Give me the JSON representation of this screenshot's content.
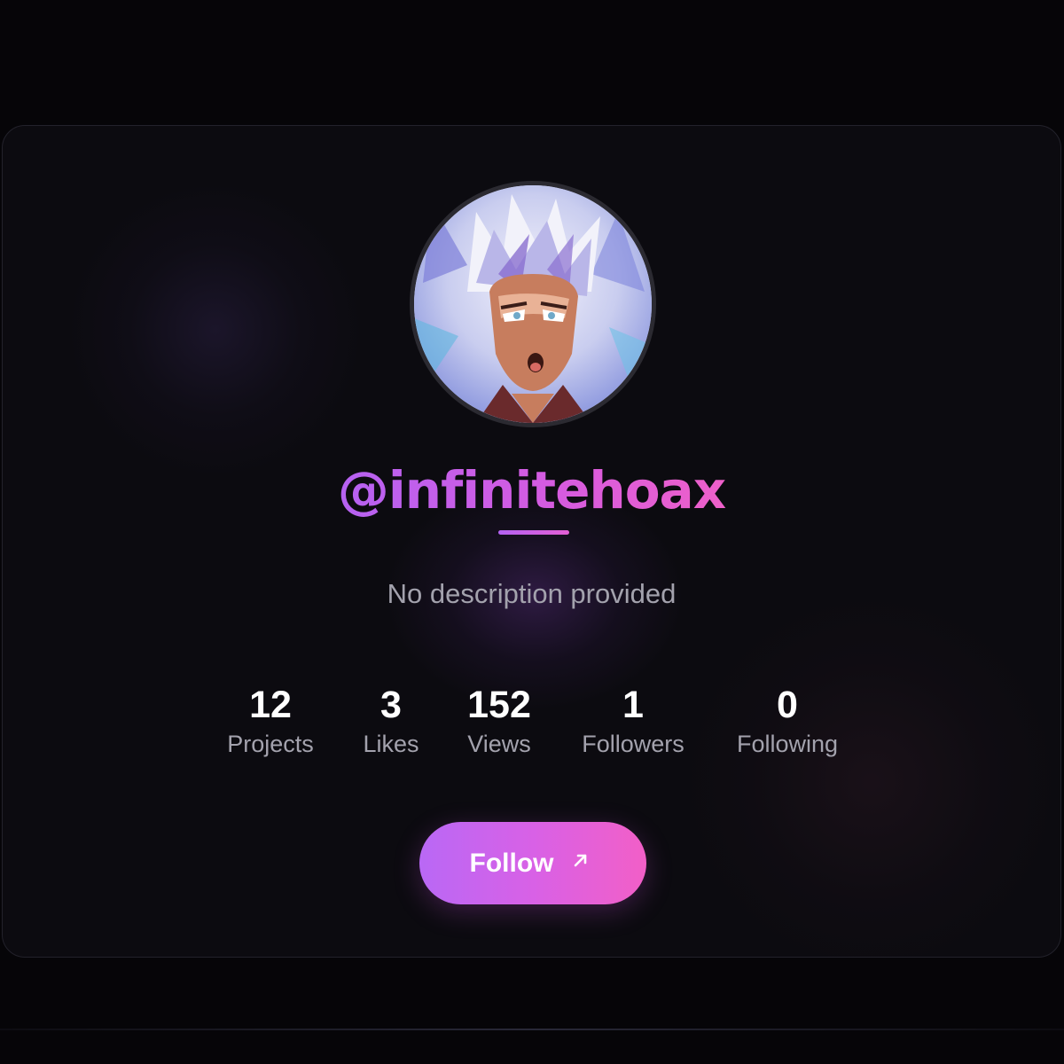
{
  "profile": {
    "username": "@infinitehoax",
    "description": "No description provided",
    "avatar_icon": "anime-avatar-image"
  },
  "stats": [
    {
      "value": "12",
      "label": "Projects"
    },
    {
      "value": "3",
      "label": "Likes"
    },
    {
      "value": "152",
      "label": "Views"
    },
    {
      "value": "1",
      "label": "Followers"
    },
    {
      "value": "0",
      "label": "Following"
    }
  ],
  "actions": {
    "follow_label": "Follow",
    "follow_icon": "arrow-up-right-icon"
  },
  "colors": {
    "background": "#060508",
    "card": "#0c0b10",
    "accent_start": "#b462f2",
    "accent_end": "#f060c8",
    "muted_text": "#a3a2ad"
  }
}
